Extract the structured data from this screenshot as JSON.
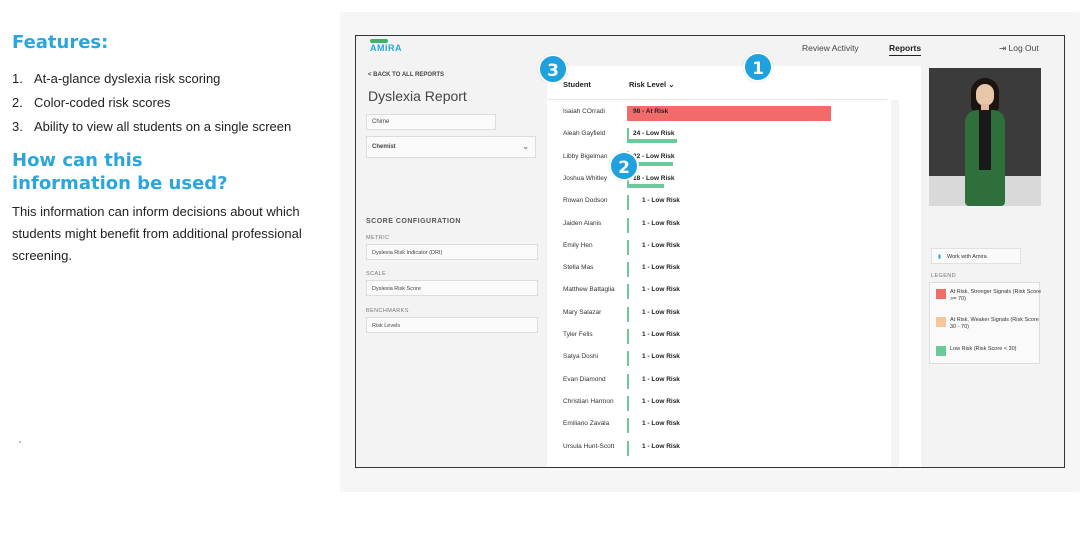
{
  "features": {
    "heading": "Features:",
    "items": [
      {
        "num": "1.",
        "text": "At-a-glance dyslexia risk scoring"
      },
      {
        "num": "2.",
        "text": "Color-coded risk scores"
      },
      {
        "num": "3.",
        "text": "Ability to view all students on a single screen"
      }
    ]
  },
  "usage": {
    "heading": "How can this information be used?",
    "body": "This information can inform decisions about which students might benefit from additional professional screening."
  },
  "app": {
    "logo": "AMIRA",
    "nav": {
      "review": "Review Activity",
      "reports": "Reports",
      "logout": "Log Out"
    },
    "back_link": "< BACK TO ALL REPORTS",
    "report_title": "Dyslexia Report",
    "filter_1": "Chime",
    "filter_2": "Chemist",
    "config": {
      "heading": "SCORE CONFIGURATION",
      "metric_label": "METRIC",
      "metric_value": "Dyslexia Risk Indicator (DRI)",
      "scale_label": "SCALE",
      "scale_value": "Dyslexia Risk Score",
      "benchmarks_label": "BENCHMARKS",
      "benchmarks_value": "Risk Levels"
    },
    "table": {
      "col_student": "Student",
      "col_risk": "Risk Level ⌄",
      "rows": [
        {
          "name": "Isaiah COrradi",
          "label": "98 - At Risk",
          "score": 98,
          "level": "at-risk"
        },
        {
          "name": "Aleah Gayfield",
          "label": "24 - Low Risk",
          "score": 24,
          "level": "low"
        },
        {
          "name": "Libby Bigelman",
          "label": "22 - Low Risk",
          "score": 22,
          "level": "low"
        },
        {
          "name": "Joshua Whitley",
          "label": "18 - Low Risk",
          "score": 18,
          "level": "low"
        },
        {
          "name": "Rowan Dodson",
          "label": "1 - Low Risk",
          "score": 1,
          "level": "low"
        },
        {
          "name": "Jaiden Alanis",
          "label": "1 - Low Risk",
          "score": 1,
          "level": "low"
        },
        {
          "name": "Emily Hen",
          "label": "1 - Low Risk",
          "score": 1,
          "level": "low"
        },
        {
          "name": "Stella Mas",
          "label": "1 - Low Risk",
          "score": 1,
          "level": "low"
        },
        {
          "name": "Matthew Battaglia",
          "label": "1 - Low Risk",
          "score": 1,
          "level": "low"
        },
        {
          "name": "Mary Salazar",
          "label": "1 - Low Risk",
          "score": 1,
          "level": "low"
        },
        {
          "name": "Tyler Felis",
          "label": "1 - Low Risk",
          "score": 1,
          "level": "low"
        },
        {
          "name": "Satya Doshi",
          "label": "1 - Low Risk",
          "score": 1,
          "level": "low"
        },
        {
          "name": "Evan Diamond",
          "label": "1 - Low Risk",
          "score": 1,
          "level": "low"
        },
        {
          "name": "Christian Harmon",
          "label": "1 - Low Risk",
          "score": 1,
          "level": "low"
        },
        {
          "name": "Emiliano Zavala",
          "label": "1 - Low Risk",
          "score": 1,
          "level": "low"
        },
        {
          "name": "Ursula Hunt-Scott",
          "label": "1 - Low Risk",
          "score": 1,
          "level": "low"
        }
      ]
    },
    "work_button": "Work with Amira",
    "legend": {
      "heading": "LEGEND",
      "items": [
        {
          "label": "At Risk, Stronger Signals (Risk Score >= 70)",
          "color": "#f26b6b"
        },
        {
          "label": "At Risk, Weaker Signals (Risk Score 30 - 70)",
          "color": "#f7c59a"
        },
        {
          "label": "Low Risk (Risk Score < 30)",
          "color": "#6cc99a"
        }
      ]
    }
  },
  "badges": [
    "1",
    "2",
    "3"
  ],
  "colors": {
    "accent": "#2aa6dc",
    "at_risk": "#f26b6b",
    "low_risk": "#6cc99a",
    "badge": "#1ea1dc"
  }
}
